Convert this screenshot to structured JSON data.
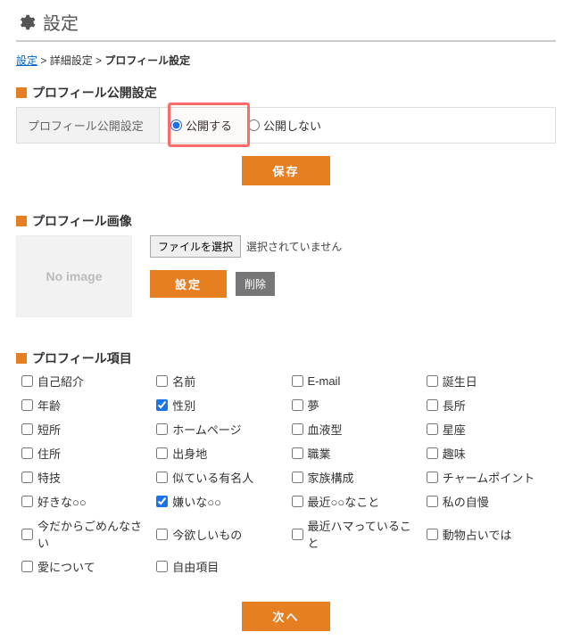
{
  "page": {
    "title": "設定"
  },
  "breadcrumb": {
    "link1": "設定",
    "sep1": " > ",
    "text2": "詳細設定",
    "sep2": " > ",
    "current": "プロフィール設定"
  },
  "section1": {
    "heading": "プロフィール公開設定",
    "row_label": "プロフィール公開設定",
    "radio_public": "公開する",
    "radio_private": "公開しない",
    "save_label": "保存"
  },
  "section2": {
    "heading": "プロフィール画像",
    "noimage_text": "No image",
    "file_button": "ファイルを選択",
    "file_status": "選択されていません",
    "set_label": "設定",
    "delete_label": "削除"
  },
  "section3": {
    "heading": "プロフィール項目",
    "items": [
      {
        "label": "自己紹介",
        "checked": false
      },
      {
        "label": "名前",
        "checked": false
      },
      {
        "label": "E-mail",
        "checked": false
      },
      {
        "label": "誕生日",
        "checked": false
      },
      {
        "label": "年齢",
        "checked": false
      },
      {
        "label": "性別",
        "checked": true
      },
      {
        "label": "夢",
        "checked": false
      },
      {
        "label": "長所",
        "checked": false
      },
      {
        "label": "短所",
        "checked": false
      },
      {
        "label": "ホームページ",
        "checked": false
      },
      {
        "label": "血液型",
        "checked": false
      },
      {
        "label": "星座",
        "checked": false
      },
      {
        "label": "住所",
        "checked": false
      },
      {
        "label": "出身地",
        "checked": false
      },
      {
        "label": "職業",
        "checked": false
      },
      {
        "label": "趣味",
        "checked": false
      },
      {
        "label": "特技",
        "checked": false
      },
      {
        "label": "似ている有名人",
        "checked": false
      },
      {
        "label": "家族構成",
        "checked": false
      },
      {
        "label": "チャームポイント",
        "checked": false
      },
      {
        "label": "好きな○○",
        "checked": false
      },
      {
        "label": "嫌いな○○",
        "checked": true
      },
      {
        "label": "最近○○なこと",
        "checked": false
      },
      {
        "label": "私の自慢",
        "checked": false
      },
      {
        "label": "今だからごめんなさい",
        "checked": false
      },
      {
        "label": "今欲しいもの",
        "checked": false
      },
      {
        "label": "最近ハマっていること",
        "checked": false
      },
      {
        "label": "動物占いでは",
        "checked": false
      },
      {
        "label": "愛について",
        "checked": false
      },
      {
        "label": "自由項目",
        "checked": false
      }
    ],
    "next_label": "次へ"
  }
}
